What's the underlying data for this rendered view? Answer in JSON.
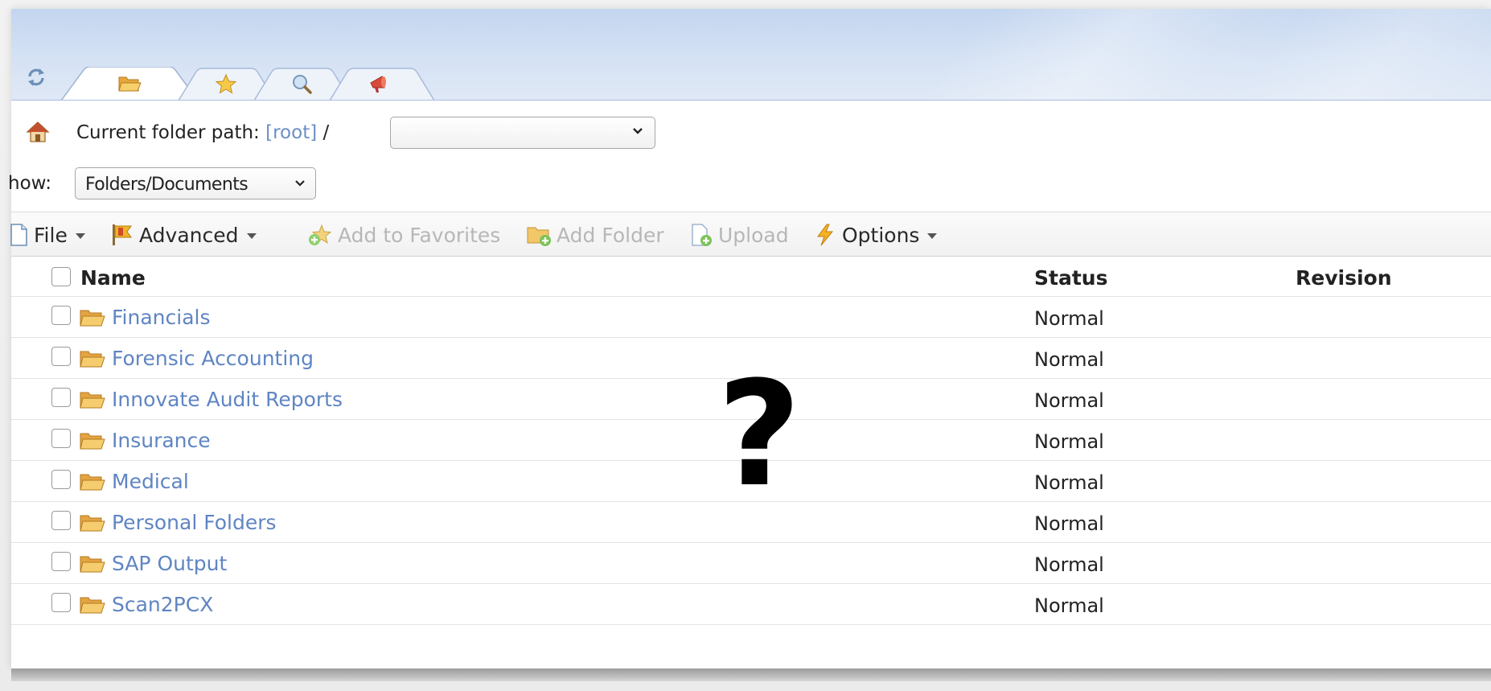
{
  "tabs": [
    {
      "name": "folders",
      "icon": "folder-open-icon",
      "active": true
    },
    {
      "name": "favorites",
      "icon": "star-icon",
      "active": false
    },
    {
      "name": "search",
      "icon": "magnifier-icon",
      "active": false
    },
    {
      "name": "alerts",
      "icon": "megaphone-icon",
      "active": false
    }
  ],
  "path": {
    "label": "Current folder path:",
    "root_link": "[root]",
    "separator": "/",
    "selected_value": ""
  },
  "show": {
    "label": "how:",
    "selected": "Folders/Documents"
  },
  "toolbar": {
    "file": "File",
    "advanced": "Advanced",
    "add_to_favorites": "Add to Favorites",
    "add_folder": "Add Folder",
    "upload": "Upload",
    "options": "Options"
  },
  "grid": {
    "columns": {
      "name": "Name",
      "status": "Status",
      "revision": "Revision"
    },
    "rows": [
      {
        "name": "Financials",
        "status": "Normal"
      },
      {
        "name": "Forensic Accounting",
        "status": "Normal"
      },
      {
        "name": "Innovate Audit Reports",
        "status": "Normal"
      },
      {
        "name": "Insurance",
        "status": "Normal"
      },
      {
        "name": "Medical",
        "status": "Normal"
      },
      {
        "name": "Personal Folders",
        "status": "Normal"
      },
      {
        "name": "SAP Output",
        "status": "Normal"
      },
      {
        "name": "Scan2PCX",
        "status": "Normal"
      }
    ]
  },
  "overlay": {
    "mark": "?"
  },
  "colors": {
    "link": "#5f85c2",
    "header_bg": "#c3d5ef",
    "toolbar_bg": "#f1f1f1"
  }
}
